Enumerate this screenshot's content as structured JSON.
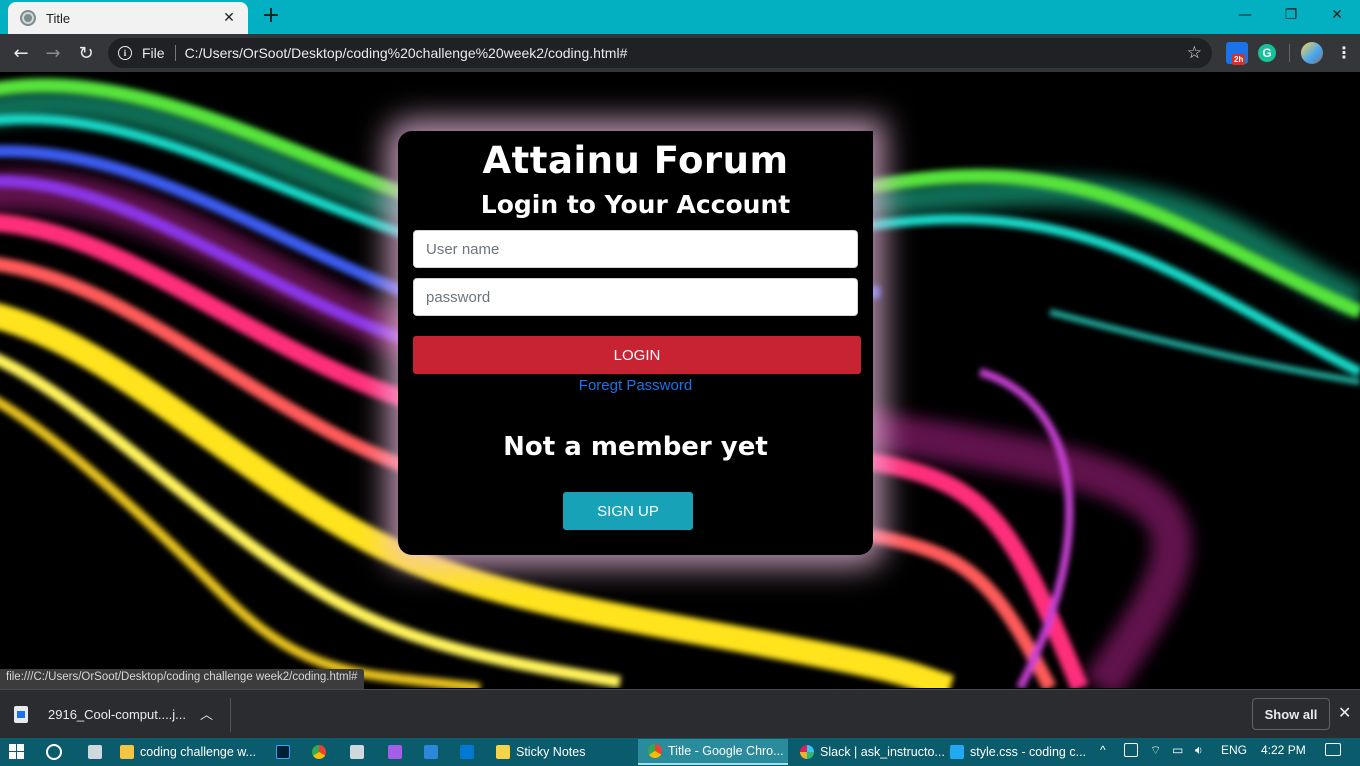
{
  "browser": {
    "tab_title": "Title",
    "url_scheme": "File",
    "url": "C:/Users/OrSoot/Desktop/coding%20challenge%20week2/coding.html#",
    "extension_badge": "2h",
    "grammarly_letter": "G"
  },
  "page": {
    "title": "Attainu Forum",
    "subtitle": "Login to Your Account",
    "username_placeholder": "User name",
    "password_placeholder": "password",
    "login_label": "LOGIN",
    "forgot_label": "Foregt Password",
    "not_member": "Not a member yet",
    "signup_label": "SIGN UP"
  },
  "status_url": "file:///C:/Users/OrSoot/Desktop/coding challenge week2/coding.html#",
  "downloads": {
    "file_name": "2916_Cool-comput....j...",
    "show_all_label": "Show all"
  },
  "taskbar": {
    "apps": [
      {
        "label": "coding challenge w...",
        "color": "#f4c542"
      },
      {
        "label": "",
        "color": "#001e36"
      },
      {
        "label": "",
        "color": "#e94235"
      },
      {
        "label": "",
        "color": "#cfd8dc"
      },
      {
        "label": "",
        "color": "#a55ee8"
      },
      {
        "label": "",
        "color": "#2b88d8"
      },
      {
        "label": "",
        "color": "#0078d4"
      },
      {
        "label": "Sticky Notes",
        "color": "#f7d34a"
      },
      {
        "label": "Title - Google Chro...",
        "color": "#e94235"
      },
      {
        "label": "Slack | ask_instructo...",
        "color": "#ecb22e"
      },
      {
        "label": "style.css - coding c...",
        "color": "#23a9f2"
      }
    ],
    "language": "ENG",
    "time": "4:22 PM"
  },
  "colors": {
    "tabbar": "#02b0c2",
    "login_button": "#c82333",
    "signup_button": "#17a2b8",
    "link": "#1a73e8",
    "card_glow": "#f0bee1"
  }
}
